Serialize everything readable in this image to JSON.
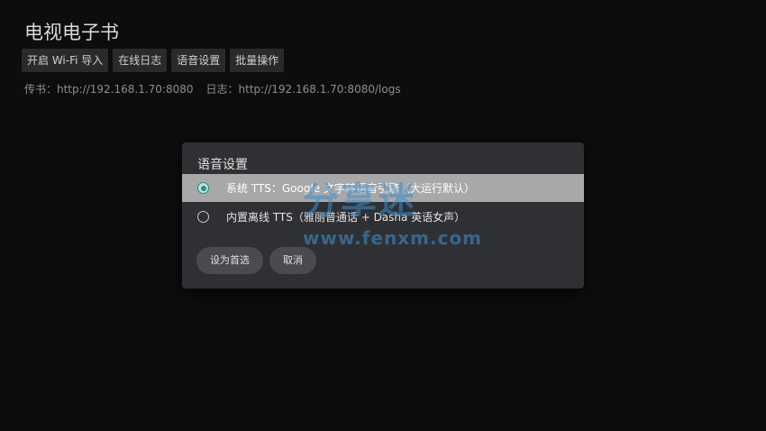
{
  "app": {
    "title": "电视电子书"
  },
  "toolbar": {
    "buttons": [
      {
        "label": "开启 Wi-Fi 导入"
      },
      {
        "label": "在线日志"
      },
      {
        "label": "语音设置"
      },
      {
        "label": "批量操作"
      }
    ]
  },
  "urls": {
    "upload": "传书：http://192.168.1.70:8080",
    "logs": "日志：http://192.168.1.70:8080/logs"
  },
  "dialog": {
    "title": "语音设置",
    "options": [
      {
        "label": "系统 TTS：Google 文字转语音引擎（大运行默认）",
        "selected": true
      },
      {
        "label": "内置离线 TTS（雅丽普通话 + Dasha 英语女声）",
        "selected": false
      }
    ],
    "buttons": {
      "confirm": "设为首选",
      "cancel": "取消"
    },
    "colors": {
      "accent": "#2b8c7a",
      "selected_row": "#a8a8a8",
      "surface": "#2f3033"
    }
  },
  "watermark": {
    "text": "分享迷",
    "url": "www.fenxm.com"
  }
}
